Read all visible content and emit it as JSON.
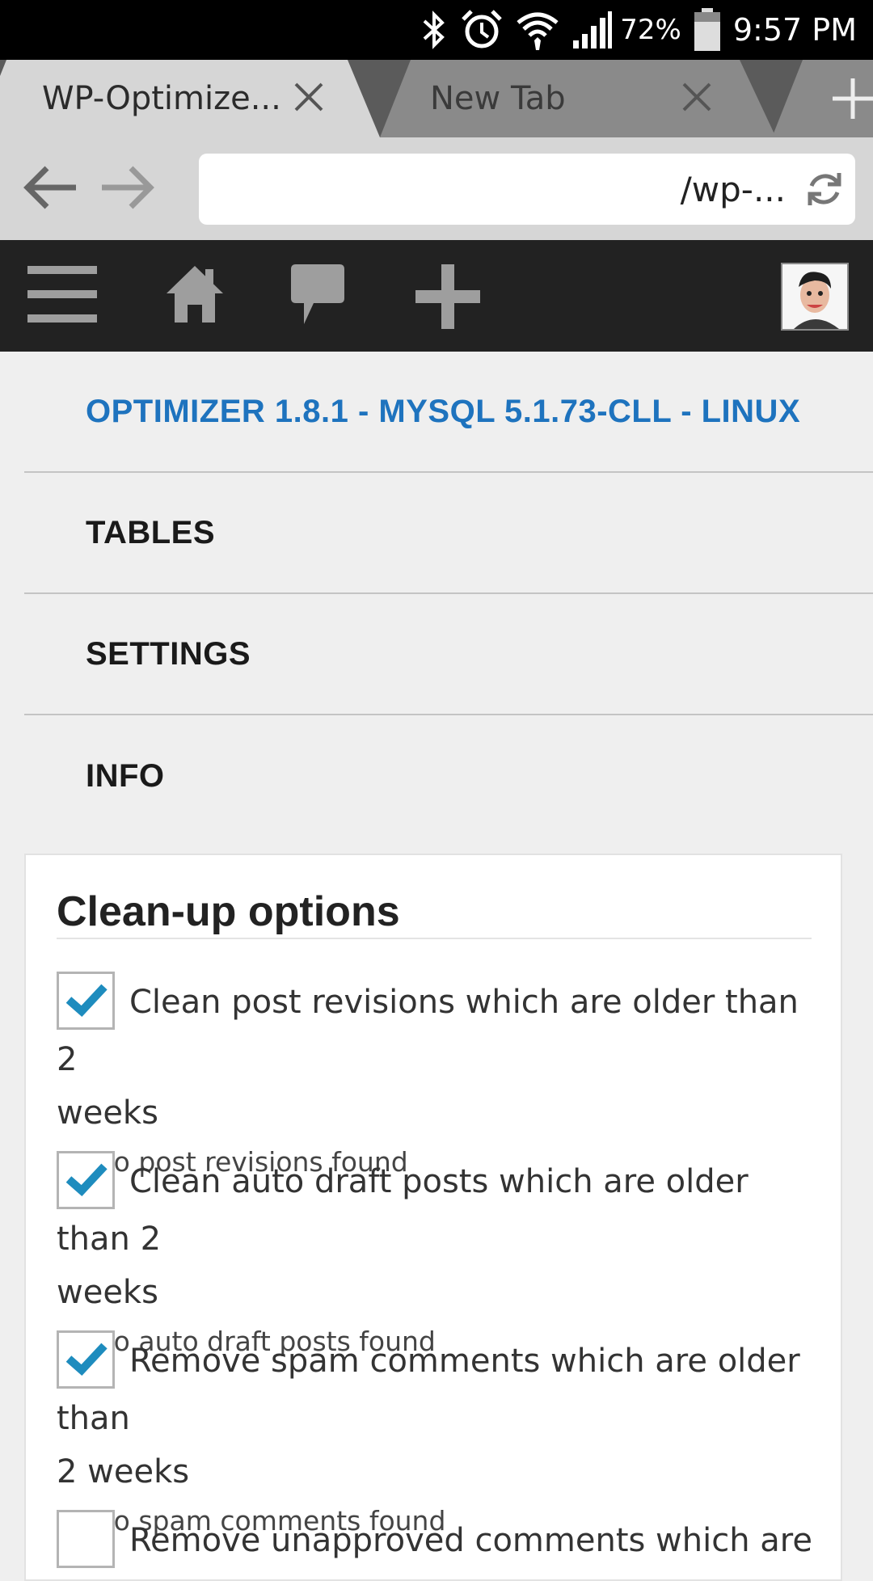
{
  "status_bar": {
    "battery_percent": "72%",
    "time": "9:57 PM",
    "icons": [
      "bluetooth-icon",
      "alarm-icon",
      "wifi-icon",
      "signal-icon",
      "battery-icon"
    ]
  },
  "tabs": [
    {
      "title": "WP-Optimize...",
      "active": true
    },
    {
      "title": "New Tab",
      "active": false
    }
  ],
  "toolbar": {
    "url_text": "/wp-..."
  },
  "admin_bar": {
    "icons": [
      "menu-icon",
      "home-icon",
      "comment-icon",
      "add-icon",
      "avatar"
    ]
  },
  "plugin_nav": {
    "items": [
      {
        "label": "OPTIMIZER 1.8.1 - MYSQL 5.1.73-CLL - LINUX",
        "active": true
      },
      {
        "label": "TABLES",
        "active": false
      },
      {
        "label": "SETTINGS",
        "active": false
      },
      {
        "label": "INFO",
        "active": false
      }
    ]
  },
  "cleanup": {
    "title": "Clean-up options",
    "options": [
      {
        "line1": "Clean post revisions which are older than 2",
        "line2": "weeks",
        "note": "No post revisions found",
        "checked": true
      },
      {
        "line1": "Clean auto draft posts which are older than 2",
        "line2": "weeks",
        "note": "No auto draft posts found",
        "checked": true
      },
      {
        "line1": "Remove spam comments which are older than",
        "line2": "2 weeks",
        "note": "No spam comments found",
        "checked": true
      },
      {
        "line1": "Remove unapproved comments which are",
        "line2": "",
        "note": "",
        "checked": false
      }
    ]
  },
  "colors": {
    "accent": "#1e73be",
    "admin_bar": "#222222",
    "check": "#1e8cbe"
  }
}
